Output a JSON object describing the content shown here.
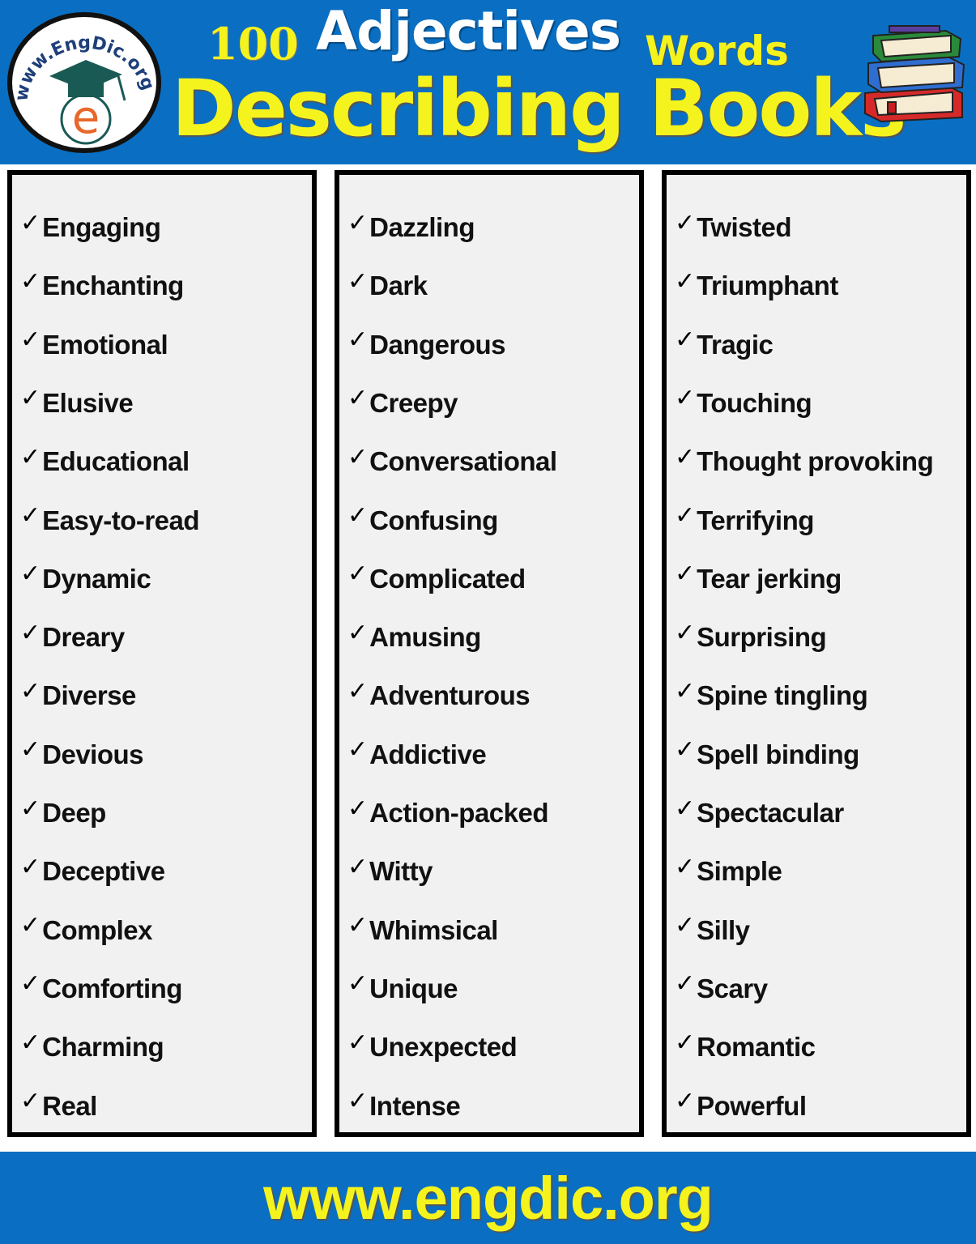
{
  "header": {
    "logo_text": "www.EngDic.org",
    "title_number": "100",
    "title_adjectives": "Adjectives",
    "title_words": "Words",
    "title_main": "Describing Books",
    "logo_icon": "graduation-cap-e-logo",
    "books_icon": "stack-of-books-icon"
  },
  "check_icon": "✓",
  "columns": [
    {
      "items": [
        "Engaging",
        "Enchanting",
        "Emotional",
        "Elusive",
        "Educational",
        "Easy-to-read",
        "Dynamic",
        "Dreary",
        "Diverse",
        "Devious",
        "Deep",
        "Deceptive",
        "Complex",
        "Comforting",
        "Charming",
        "Real"
      ]
    },
    {
      "items": [
        "Dazzling",
        "Dark",
        "Dangerous",
        "Creepy",
        "Conversational",
        "Confusing",
        "Complicated",
        "Amusing",
        "Adventurous",
        "Addictive",
        "Action-packed",
        "Witty",
        "Whimsical",
        "Unique",
        "Unexpected",
        "Intense"
      ]
    },
    {
      "items": [
        "Twisted",
        "Triumphant",
        "Tragic",
        "Touching",
        "Thought provoking",
        "Terrifying",
        "Tear jerking",
        "Surprising",
        "Spine tingling",
        "Spell binding",
        "Spectacular",
        "Simple",
        "Silly",
        "Scary",
        "Romantic",
        "Powerful"
      ]
    }
  ],
  "footer": {
    "url": "www.engdic.org"
  },
  "colors": {
    "brand_blue": "#0a6fc2",
    "title_yellow": "#f5f31e",
    "panel_bg": "#f1f1f1"
  }
}
